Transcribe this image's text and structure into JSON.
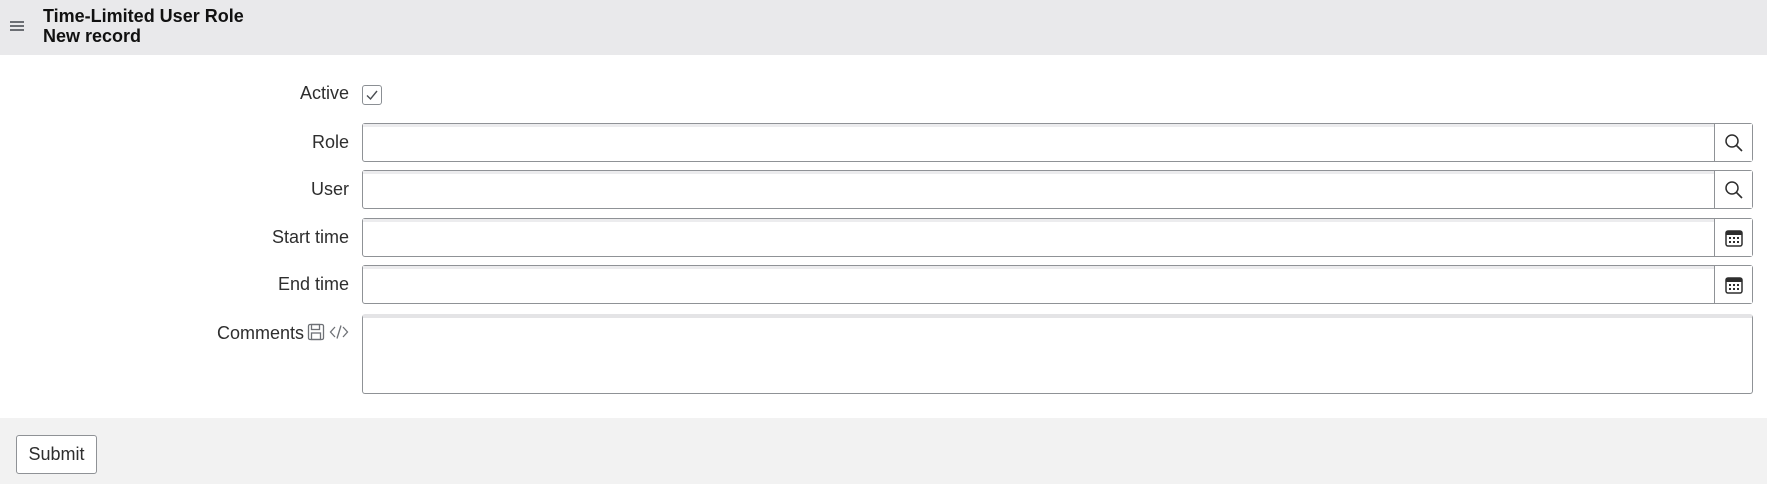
{
  "header": {
    "table_title": "Time-Limited User Role",
    "record_title": "New record",
    "menu_icon": "hamburger-icon"
  },
  "form": {
    "active": {
      "label": "Active",
      "checked": true
    },
    "role": {
      "label": "Role",
      "value": "",
      "button_icon": "search-icon"
    },
    "user": {
      "label": "User",
      "value": "",
      "button_icon": "search-icon"
    },
    "start_time": {
      "label": "Start time",
      "value": "",
      "button_icon": "calendar-icon"
    },
    "end_time": {
      "label": "End time",
      "value": "",
      "button_icon": "calendar-icon"
    },
    "comments": {
      "label": "Comments",
      "value": "",
      "icons": [
        "save-icon",
        "code-icon"
      ]
    }
  },
  "footer": {
    "submit_label": "Submit"
  },
  "colors": {
    "header_bg": "#e9e9eb",
    "footer_bg": "#f2f2f2",
    "border": "#8f9296",
    "text": "#2e2e2e"
  }
}
